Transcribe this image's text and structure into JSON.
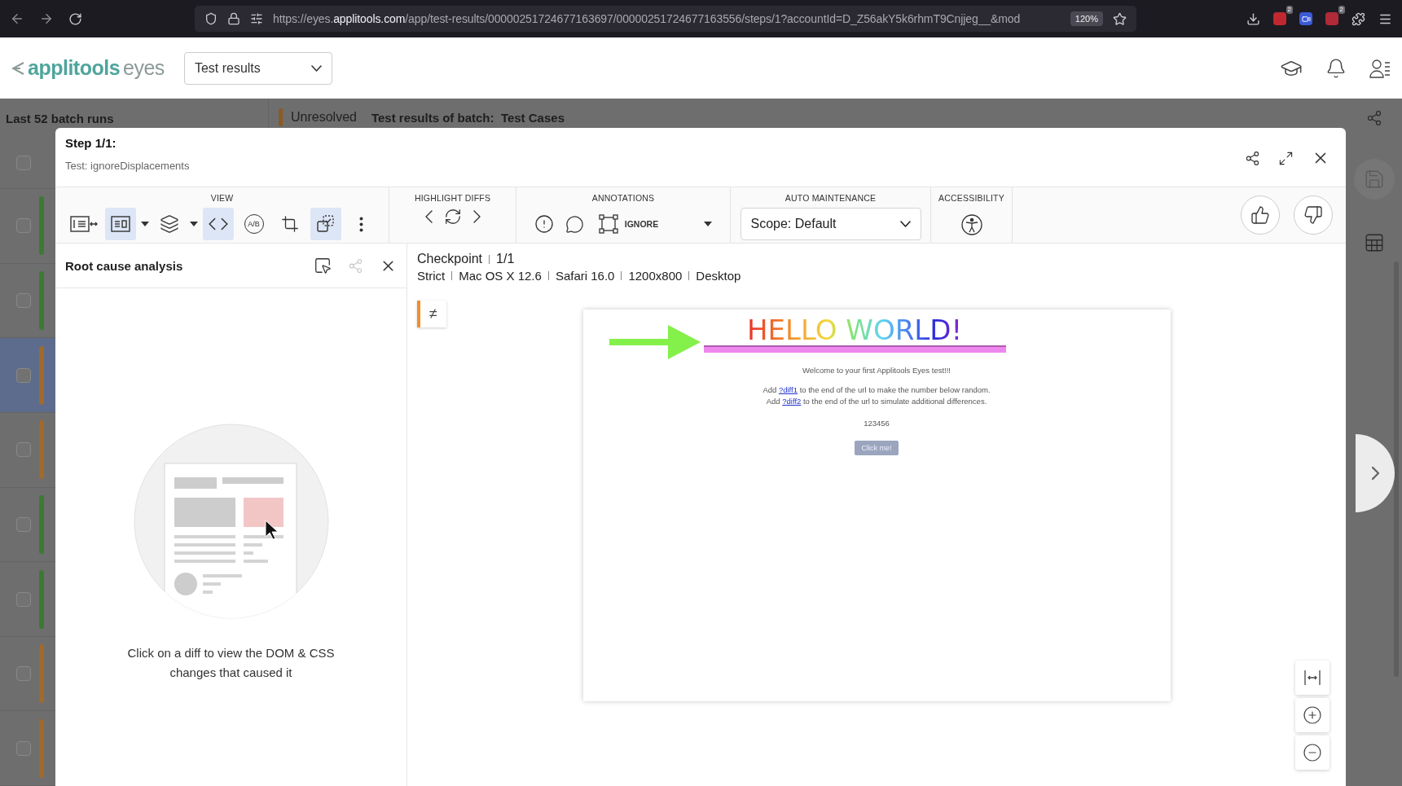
{
  "browser": {
    "url_host": "https://eyes.",
    "url_domain": "applitools.com",
    "url_path": "/app/test-results/00000251724677163697/00000251724677163556/steps/1?accountId=D_Z56akY5k6rhmT9Cnjjeg__&mod",
    "zoom": "120%",
    "extension_badges": [
      "2",
      "2"
    ]
  },
  "app_header": {
    "logo_main": "applitools",
    "logo_sub": "eyes",
    "view_select": "Test results"
  },
  "background": {
    "sidebar_title": "Last 52 batch runs",
    "select_all_checked": false,
    "status": "Unresolved",
    "batch_label": "Test results of batch:",
    "batch_name": "Test Cases",
    "rows": [
      {
        "color": "#3b7a34",
        "selected": false,
        "checked": false
      },
      {
        "color": "#3b7a34",
        "selected": false,
        "checked": false
      },
      {
        "color": "#a06a2c",
        "selected": true,
        "checked": false
      },
      {
        "color": "#a06a2c",
        "selected": false,
        "checked": false
      },
      {
        "color": "#3b7a34",
        "selected": false,
        "checked": false
      },
      {
        "color": "#3b7a34",
        "selected": false,
        "checked": false
      },
      {
        "color": "#a06a2c",
        "selected": false,
        "checked": false
      },
      {
        "color": "#a06a2c",
        "selected": false,
        "checked": false
      }
    ]
  },
  "step": {
    "title": "Step 1/1:",
    "test": "Test: ignoreDisplacements"
  },
  "toolbar": {
    "view_title": "VIEW",
    "view_tools": [
      {
        "kind": "compare",
        "selected": false
      },
      {
        "kind": "single",
        "selected": true
      },
      {
        "kind": "layers",
        "selected": false
      },
      {
        "kind": "code",
        "selected": true
      },
      {
        "kind": "ab",
        "label": "A/B",
        "selected": false
      },
      {
        "kind": "crop",
        "selected": false
      },
      {
        "kind": "overlay",
        "selected": true
      },
      {
        "kind": "more",
        "selected": false
      }
    ],
    "highlight_title": "HIGHLIGHT DIFFS",
    "annotations_title": "ANNOTATIONS",
    "ignore_label": "IGNORE",
    "maintenance_title": "AUTO MAINTENANCE",
    "scope": "Scope: Default",
    "accessibility_title": "ACCESSIBILITY"
  },
  "panel": {
    "title": "Root cause analysis",
    "share_disabled": true,
    "message": "Click on a diff to view the DOM & CSS changes that caused it"
  },
  "checkpoint": {
    "label": "Checkpoint",
    "count": "1/1",
    "details": [
      "Strict",
      "Mac OS X 12.6",
      "Safari 16.0",
      "1200x800",
      "Desktop"
    ],
    "diff_sign": "≠"
  },
  "screenshot": {
    "headline": "HELLO WORLD!",
    "welcome": "Welcome to your first Applitools Eyes test!!!",
    "lines": [
      {
        "before": "Add",
        "link": "?diff1",
        "after": "to the end of the url to make the number below random."
      },
      {
        "before": "Add",
        "link": "?diff2",
        "after": "to the end of the url to simulate additional differences."
      }
    ],
    "number": "123456",
    "button": "Click me!"
  }
}
